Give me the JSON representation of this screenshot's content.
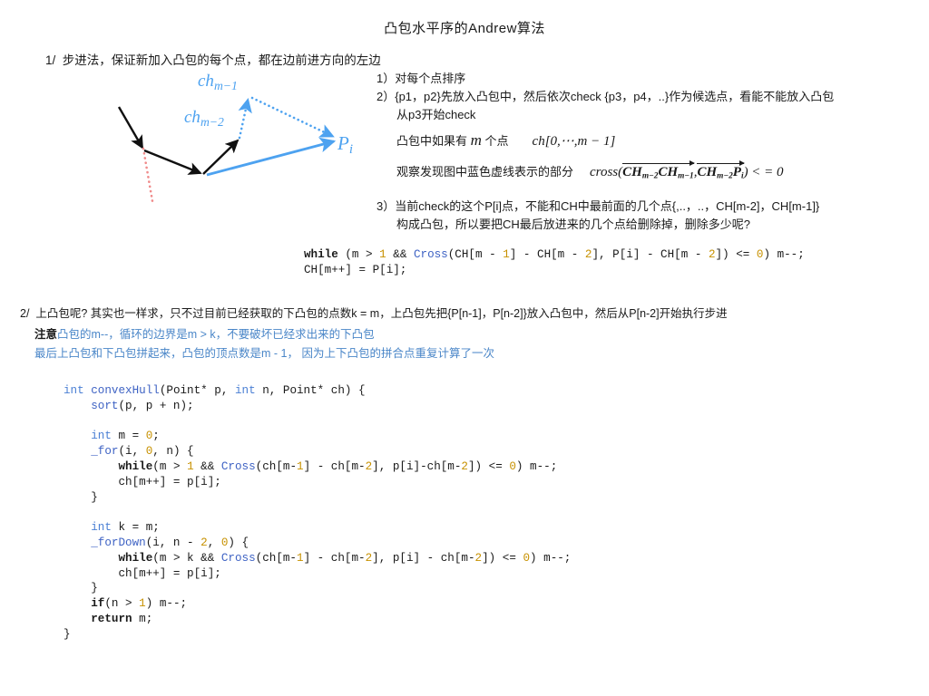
{
  "document": {
    "title": "凸包水平序的Andrew算法"
  },
  "section1": {
    "heading": "1/  步进法，保证新加入凸包的每个点，都在边前进方向的左边",
    "items": {
      "one": "1）对每个点排序",
      "two": "2）{p1，p2}先放入凸包中，然后依次check {p3，p4，..}作为候选点，看能不能放入凸包",
      "two_cont": "从p3开始check",
      "three": "3）当前check的这个P[i]点，不能和CH中最前面的几个点{,..，..，CH[m-2]，CH[m-1]}",
      "three_cont": "构成凸包，所以要把CH最后放进来的几个点给删除掉，删除多少呢?"
    },
    "math": {
      "line1_prefix": "凸包中如果有 ",
      "line1_m": "m",
      "line1_mid": " 个点",
      "line1_expr": "ch[0,⋯,m − 1]",
      "line2_prefix": "观察发现图中蓝色虚线表示的部分",
      "line2_cross": "cross",
      "line2_vec1_base": "CH",
      "line2_vec1_sub1": "m−2",
      "line2_vec1_base2": "CH",
      "line2_vec1_sub2": "m−1",
      "line2_vec2_base": "CH",
      "line2_vec2_sub1": "m−2",
      "line2_vec2_base2": "P",
      "line2_vec2_sub2": "i",
      "line2_tail": ") < = 0"
    },
    "while_code": {
      "line1": "while (m > 1 && Cross(CH[m - 1] - CH[m - 2], P[i] - CH[m - 2]) <= 0) m--;",
      "line2": "CH[m++] = P[i];"
    }
  },
  "diagram": {
    "labels": {
      "ch_m1_base": "ch",
      "ch_m1_sub": "m−1",
      "ch_m2_base": "ch",
      "ch_m2_sub": "m−2",
      "pi_base": "P",
      "pi_sub": "i"
    },
    "colors": {
      "blue": "#4da2f0",
      "black": "#101010",
      "red_dotted": "#f08b8b"
    }
  },
  "section2": {
    "heading": "2/  上凸包呢? 其实也一样求，只不过目前已经获取的下凸包的点数k = m，上凸包先把{P[n-1]，P[n-2]}放入凸包中，然后从P[n-2]开始执行步进",
    "note1_bold": "注意",
    "note1": "凸包的m--，循环的边界是m > k，不要破坏已经求出来的下凸包",
    "note2": "最后上凸包和下凸包拼起来，凸包的顶点数是m - 1， 因为上下凸包的拼合点重复计算了一次"
  },
  "main_code": {
    "lines": [
      "int convexHull(Point* p, int n, Point* ch) {",
      "    sort(p, p + n);",
      "",
      "    int m = 0;",
      "    _for(i, 0, n) {",
      "        while(m > 1 && Cross(ch[m-1] - ch[m-2], p[i]-ch[m-2]) <= 0) m--;",
      "        ch[m++] = p[i];",
      "    }",
      "",
      "    int k = m;",
      "    _forDown(i, n - 2, 0) {",
      "        while(m > k && Cross(ch[m-1] - ch[m-2], p[i] - ch[m-2]) <= 0) m--;",
      "        ch[m++] = p[i];",
      "    }",
      "    if(n > 1) m--;",
      "    return m;",
      "}"
    ]
  },
  "theme": {
    "code_keyword": "#1a1a1a",
    "code_type": "#4a7fd4",
    "code_function": "#3f63c4",
    "code_number": "#c79100",
    "note_blue": "#4a86c8"
  }
}
